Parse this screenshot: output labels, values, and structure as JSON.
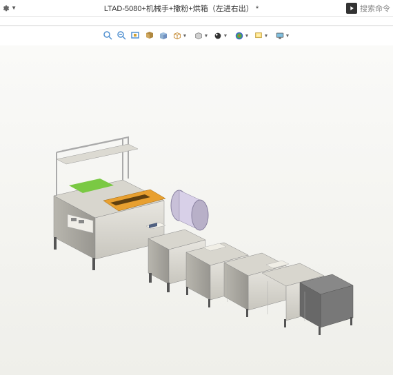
{
  "header": {
    "title": "LTAD-5080+机械手+撒粉+烘箱（左进右出） *",
    "search_label": "搜索命令"
  },
  "toolbar": {
    "items": [
      {
        "name": "zoom-in-icon"
      },
      {
        "name": "zoom-out-icon"
      },
      {
        "name": "zoom-fit-icon"
      },
      {
        "name": "zoom-area-icon"
      },
      {
        "name": "rotate-view-icon"
      },
      {
        "name": "pan-icon"
      },
      {
        "name": "section-view-icon"
      },
      {
        "name": "display-style-icon"
      },
      {
        "name": "hide-show-icon"
      },
      {
        "name": "appearance-icon"
      },
      {
        "name": "scene-icon"
      },
      {
        "name": "view-settings-icon"
      }
    ]
  }
}
